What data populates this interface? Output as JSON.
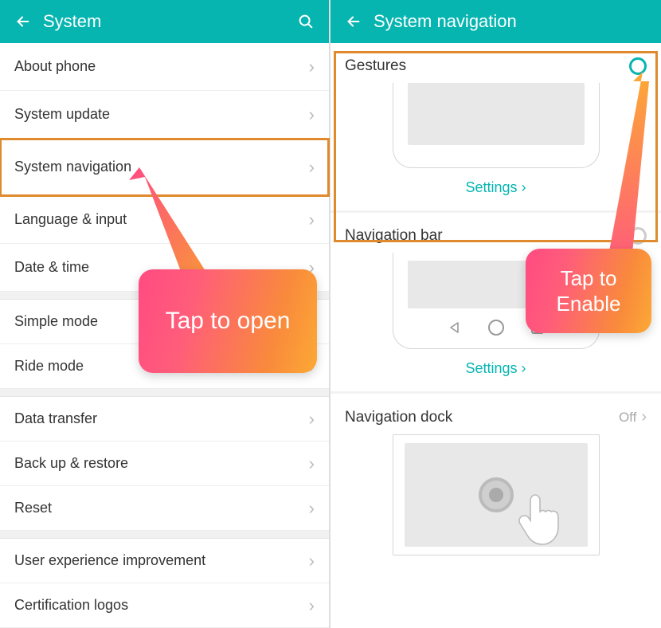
{
  "left": {
    "header": {
      "title": "System"
    },
    "rows": [
      {
        "label": "About phone"
      },
      {
        "label": "System update"
      },
      {
        "label": "System navigation",
        "highlight": true
      },
      {
        "label": "Language & input"
      },
      {
        "label": "Date & time"
      }
    ],
    "group2": [
      {
        "label": "Simple mode"
      },
      {
        "label": "Ride mode"
      }
    ],
    "group3": [
      {
        "label": "Data transfer"
      },
      {
        "label": "Back up & restore"
      },
      {
        "label": "Reset"
      }
    ],
    "group4": [
      {
        "label": "User experience improvement"
      },
      {
        "label": "Certification logos"
      }
    ],
    "callout": "Tap to open"
  },
  "right": {
    "header": {
      "title": "System navigation"
    },
    "gestures": {
      "title": "Gestures",
      "settings": "Settings"
    },
    "navbar": {
      "title": "Navigation bar",
      "settings": "Settings"
    },
    "dock": {
      "title": "Navigation dock",
      "status": "Off"
    },
    "callout": "Tap to Enable"
  }
}
